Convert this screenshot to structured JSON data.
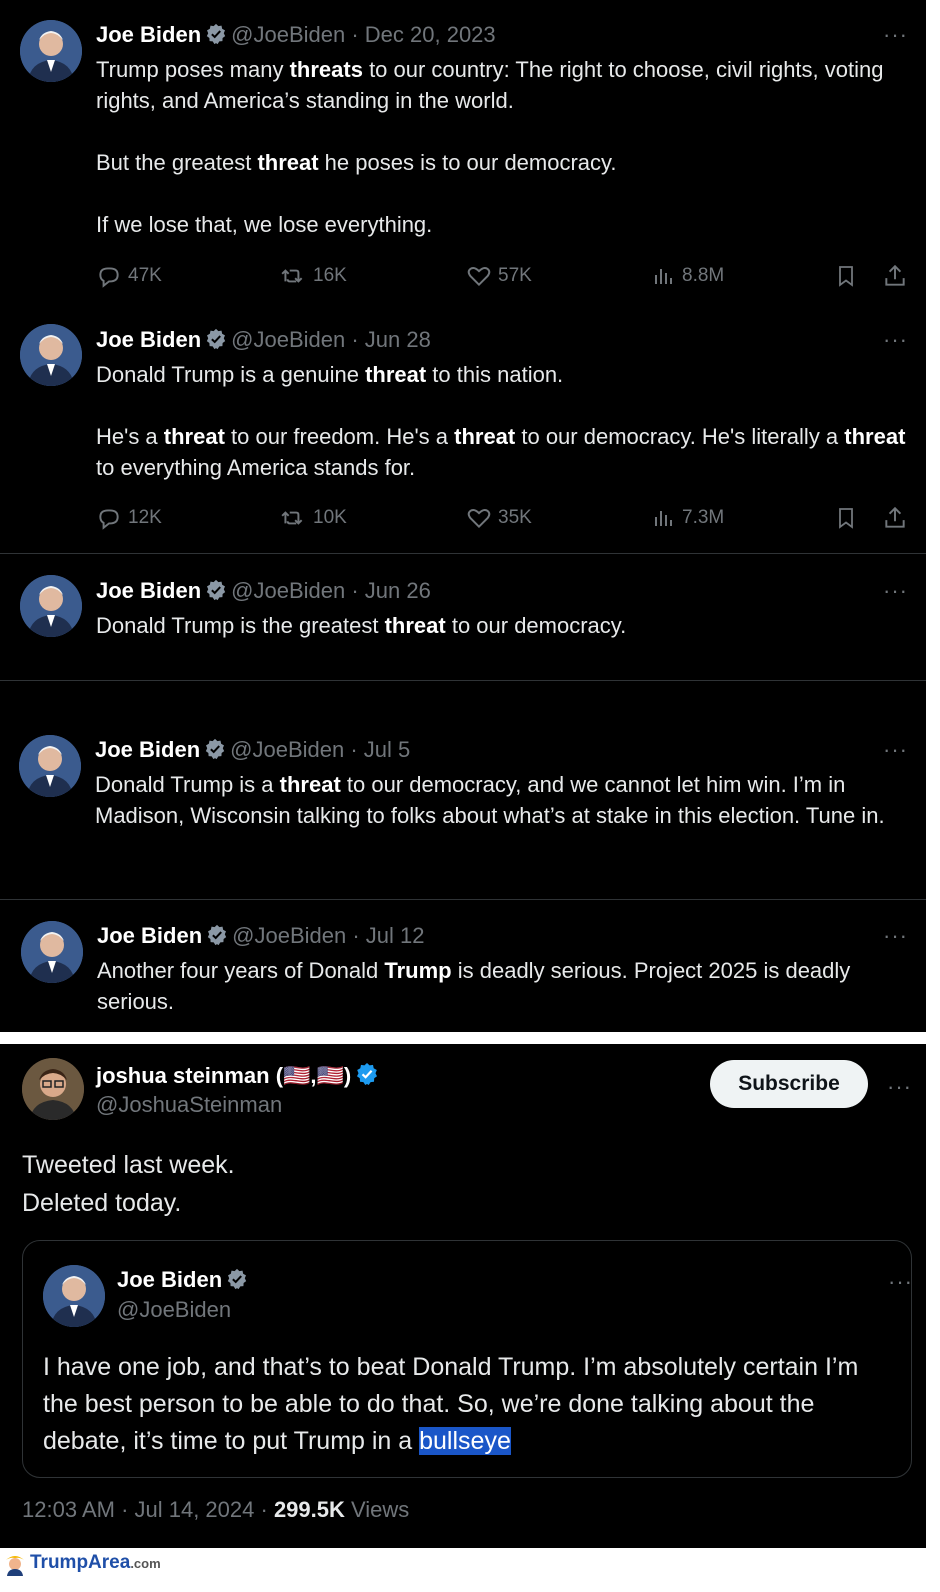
{
  "tweets": [
    {
      "name": "Joe Biden",
      "handle": "@JoeBiden",
      "date": "· Dec 20, 2023",
      "paragraphs": [
        [
          "Trump poses many ",
          {
            "b": "threats"
          },
          " to our country: The right to choose, civil rights, voting rights, and America’s standing in the world."
        ],
        [
          "But the greatest ",
          {
            "b": "threat"
          },
          " he poses is to our democracy."
        ],
        [
          "If we lose that, we lose everything."
        ]
      ],
      "stats": {
        "replies": "47K",
        "retweets": "16K",
        "likes": "57K",
        "views": "8.8M"
      }
    },
    {
      "name": "Joe Biden",
      "handle": "@JoeBiden",
      "date": "· Jun 28",
      "paragraphs": [
        [
          "Donald Trump is a genuine ",
          {
            "b": "threat"
          },
          " to this nation."
        ],
        [
          "He's a ",
          {
            "b": "threat"
          },
          " to our freedom. He's a ",
          {
            "b": "threat"
          },
          " to our democracy. He's literally a ",
          {
            "b": "threat"
          },
          " to everything America stands for."
        ]
      ],
      "stats": {
        "replies": "12K",
        "retweets": "10K",
        "likes": "35K",
        "views": "7.3M"
      }
    },
    {
      "name": "Joe Biden",
      "handle": "@JoeBiden",
      "date": "· Jun 26",
      "paragraphs": [
        [
          "Donald Trump is the greatest ",
          {
            "b": "threat"
          },
          " to our democracy."
        ]
      ]
    },
    {
      "name": "Joe Biden",
      "handle": "@JoeBiden",
      "date": "· Jul 5",
      "paragraphs": [
        [
          "Donald Trump is a ",
          {
            "b": "threat"
          },
          " to our democracy, and we cannot let him win. I’m in Madison, Wisconsin talking to folks about what’s at stake in this election. Tune in."
        ]
      ]
    },
    {
      "name": "Joe Biden",
      "handle": "@JoeBiden",
      "date": "· Jul 12",
      "paragraphs": [
        [
          "Another four years of Donald ",
          {
            "b": "Trump"
          },
          " is deadly serious. Project 2025 is deadly serious."
        ]
      ]
    }
  ],
  "steinman": {
    "name": "joshua steinman (🇺🇸,🇺🇸)",
    "handle": "@JoshuaSteinman",
    "subscribe": "Subscribe",
    "text_line1": "Tweeted last week.",
    "text_line2": "Deleted today.",
    "quote": {
      "name": "Joe Biden",
      "handle": "@JoeBiden",
      "text": "I have one job, and that’s to beat Donald Trump. I’m absolutely certain I’m the best person to be able to do that. So, we’re done talking about the debate, it’s time to put Trump in a ",
      "highlight": "bullseye"
    },
    "time": "12:03 AM · Jul 14, 2024 · ",
    "views_count": "299.5K",
    "views_label": " Views"
  },
  "more_label": "···",
  "watermark": {
    "brand": "TrumpArea",
    "tld": ".com"
  },
  "colors": {
    "verified_gray": "#8b98a5",
    "verified_blue": "#1d9bf0",
    "highlight": "#1a56c8"
  }
}
